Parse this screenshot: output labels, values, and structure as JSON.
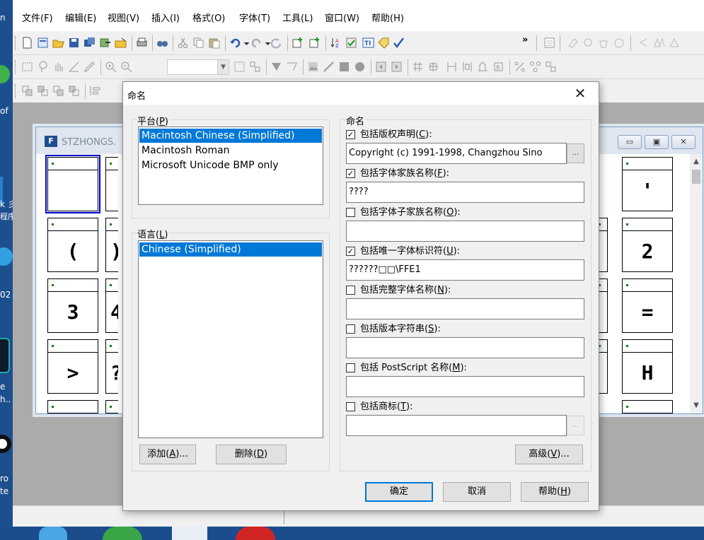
{
  "menubar": {
    "items": [
      "文件(F)",
      "编辑(E)",
      "视图(V)",
      "插入(I)",
      "格式(O)",
      "字体(T)",
      "工具(L)",
      "窗口(W)",
      "帮助(H)"
    ]
  },
  "desktop_fragments": [
    "n",
    "of",
    "k 彡",
    "程序",
    "02",
    "e",
    "h..",
    "ro",
    "te"
  ],
  "glyph_window": {
    "title": "STZHONGS.",
    "controls": [
      "minimize-icon",
      "maximize-icon",
      "close-icon"
    ],
    "glyphs_row1": [
      "",
      "",
      "'"
    ],
    "glyphs_row2": [
      "(",
      ")",
      "2"
    ],
    "glyphs_row3": [
      "3",
      "4",
      "="
    ],
    "glyphs_row4": [
      ">",
      "?",
      "H"
    ]
  },
  "dialog": {
    "title": "命名",
    "close_glyph": "✕",
    "platform": {
      "label": "平台(P)",
      "items": [
        "Macintosh Chinese (Simplified)",
        "Macintosh Roman",
        "Microsoft Unicode BMP only"
      ],
      "selected_index": 0
    },
    "language": {
      "label": "语言(L)",
      "items": [
        "Chinese (Simplified)"
      ],
      "selected_index": 0
    },
    "add_button": "添加(A)...",
    "delete_button": "删除(D)",
    "naming_group_label": "命名",
    "fields": [
      {
        "label": "包括版权声明(C):",
        "checked": true,
        "value": "Copyright (c) 1991-1998, Changzhou Sino",
        "has_button": true,
        "button_enabled": true
      },
      {
        "label": "包括字体家族名称(F):",
        "checked": true,
        "value": "????",
        "has_button": false
      },
      {
        "label": "包括字体子家族名称(O):",
        "checked": false,
        "value": "",
        "has_button": false
      },
      {
        "label": "包括唯一字体标识符(U):",
        "checked": true,
        "value": "??????□□\\FFE1",
        "has_button": false
      },
      {
        "label": "包括完整字体名称(N):",
        "checked": false,
        "value": "",
        "has_button": false
      },
      {
        "label": "包括版本字符串(S):",
        "checked": false,
        "value": "",
        "has_button": false
      },
      {
        "label": "包括 PostScript 名称(M):",
        "checked": false,
        "value": "",
        "has_button": false
      },
      {
        "label": "包括商标(T):",
        "checked": false,
        "value": "",
        "has_button": true,
        "button_enabled": false
      }
    ],
    "ellipsis": "...",
    "checkmark": "✓",
    "advanced_button": "高级(V)...",
    "ok_button": "确定",
    "cancel_button": "取消",
    "help_button": "帮助(H)"
  }
}
